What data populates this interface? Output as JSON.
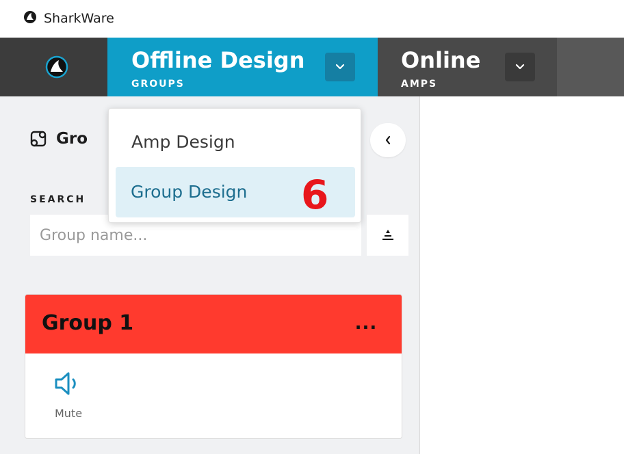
{
  "app": {
    "title": "SharkWare",
    "logo_icon": "shark-logo-icon"
  },
  "nav": {
    "tabs": [
      {
        "label": "Offline Design",
        "sublabel": "GROUPS",
        "active": true,
        "color": "#0f9ec8"
      },
      {
        "label": "Online",
        "sublabel": "AMPS",
        "active": false,
        "color": "#494949"
      }
    ]
  },
  "dropdown": {
    "items": [
      {
        "label": "Amp Design",
        "selected": false
      },
      {
        "label": "Group Design",
        "selected": true
      }
    ]
  },
  "annotation": {
    "step": "6",
    "color": "#e8161b"
  },
  "panel": {
    "title_visible": "Gro",
    "collapse_icon": "chevron-left-icon",
    "search": {
      "label": "SEARCH",
      "placeholder": "Group name..."
    },
    "sort_icon": "sort-icon"
  },
  "groups": [
    {
      "name": "Group 1",
      "color": "#ff3a2e",
      "more_label": "...",
      "controls": [
        {
          "label": "Mute",
          "icon": "speaker-icon"
        }
      ]
    }
  ]
}
